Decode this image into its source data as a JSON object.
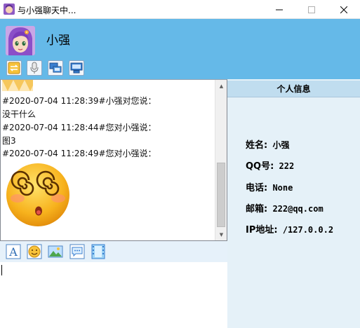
{
  "window": {
    "title": "与小强聊天中..."
  },
  "header": {
    "contact_name": "小强",
    "tools": [
      "transfer-icon",
      "microphone-icon",
      "remote-desktop-icon",
      "monitor-icon"
    ]
  },
  "chat": {
    "messages": [
      {
        "meta": "#2020-07-04 11:28:39#小强对您说：",
        "content": "没干什么"
      },
      {
        "meta": "#2020-07-04 11:28:44#您对小强说：",
        "content": "图3"
      },
      {
        "meta": "#2020-07-04 11:28:49#您对小强说：",
        "content": ""
      }
    ]
  },
  "info": {
    "heading": "个人信息",
    "name_label": "姓名:",
    "name_value": "小强",
    "qq_label": "QQ号:",
    "qq_value": "222",
    "phone_label": "电话:",
    "phone_value": "None",
    "email_label": "邮箱:",
    "email_value": "222@qq.com",
    "ip_label": "IP地址:",
    "ip_value": "/127.0.0.2"
  },
  "input_toolbar": {
    "tools": [
      "font-icon",
      "emoji-icon",
      "image-icon",
      "chat-history-icon",
      "film-icon"
    ]
  },
  "colors": {
    "header_bg": "#65b9e8",
    "info_panel_bg": "#e5f1f8",
    "info_head_bg": "#c0ddef",
    "input_toolbar_bg": "#e6f1fa"
  }
}
